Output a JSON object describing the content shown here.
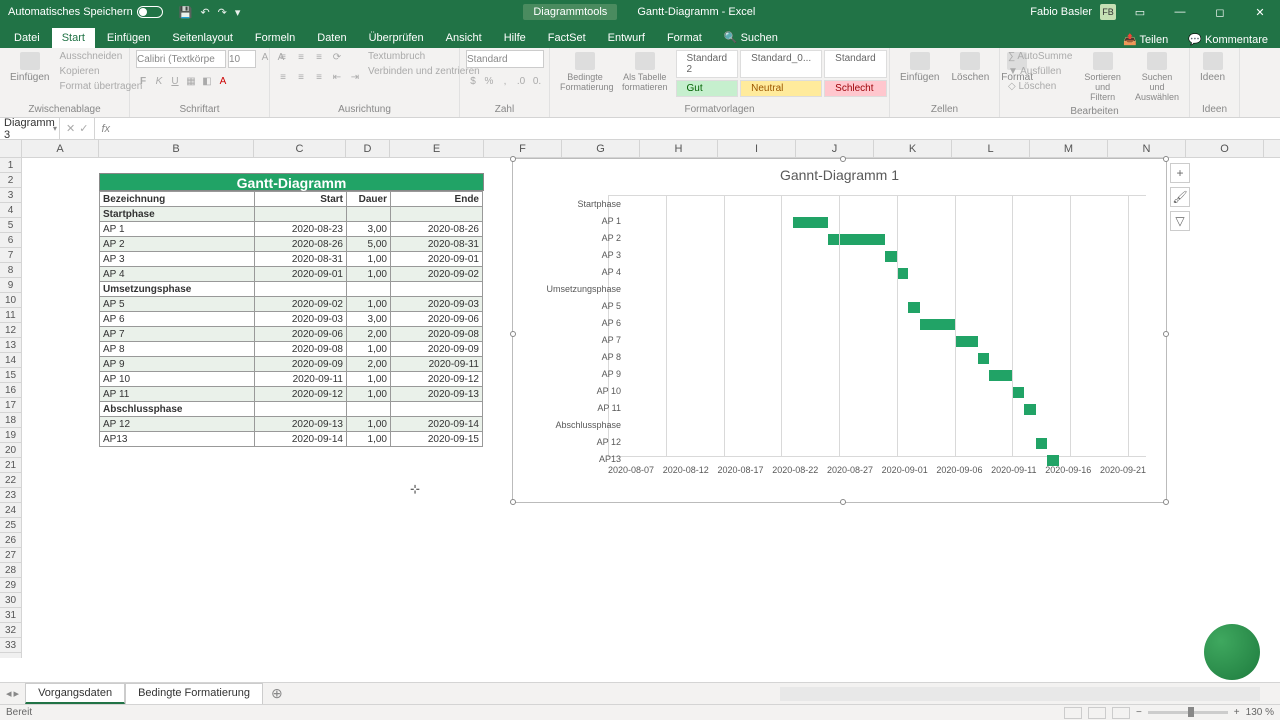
{
  "titlebar": {
    "autosave": "Automatisches Speichern",
    "tool_context": "Diagrammtools",
    "doc_title": "Gantt-Diagramm - Excel",
    "username": "Fabio Basler",
    "user_initials": "FB"
  },
  "ribbon_tabs": [
    "Datei",
    "Start",
    "Einfügen",
    "Seitenlayout",
    "Formeln",
    "Daten",
    "Überprüfen",
    "Ansicht",
    "Hilfe",
    "FactSet",
    "Entwurf",
    "Format"
  ],
  "ribbon_tabs_active": "Start",
  "ribbon_search": "Suchen",
  "ribbon_share": "Teilen",
  "ribbon_comments": "Kommentare",
  "ribbon": {
    "clipboard": {
      "label": "Zwischenablage",
      "paste": "Einfügen",
      "cut": "Ausschneiden",
      "copy": "Kopieren",
      "format_painter": "Format übertragen"
    },
    "font": {
      "label": "Schriftart",
      "name": "Calibri (Textkörpe",
      "size": "10"
    },
    "alignment": {
      "label": "Ausrichtung",
      "wrap": "Textumbruch",
      "merge": "Verbinden und zentrieren"
    },
    "number": {
      "label": "Zahl",
      "format": "Standard"
    },
    "styles": {
      "label": "Formatvorlagen",
      "cond": "Bedingte Formatierung",
      "as_table": "Als Tabelle formatieren",
      "boxes": [
        "Standard 2",
        "Standard_0...",
        "Standard",
        "Gut",
        "Neutral",
        "Schlecht"
      ]
    },
    "cells": {
      "label": "Zellen",
      "insert": "Einfügen",
      "delete": "Löschen",
      "format": "Format"
    },
    "editing": {
      "label": "Bearbeiten",
      "autosum": "AutoSumme",
      "fill": "Ausfüllen",
      "clear": "Löschen",
      "sort": "Sortieren und Filtern",
      "find": "Suchen und Auswählen"
    },
    "ideas": {
      "label": "Ideen",
      "btn": "Ideen"
    }
  },
  "name_box": "Diagramm 3",
  "columns": [
    "A",
    "B",
    "C",
    "D",
    "E",
    "F",
    "G",
    "H",
    "I",
    "J",
    "K",
    "L",
    "M",
    "N",
    "O"
  ],
  "table": {
    "title": "Gantt-Diagramm",
    "headers": [
      "Bezeichnung",
      "Start",
      "Dauer",
      "Ende"
    ],
    "rows": [
      {
        "b": "Startphase",
        "c": "",
        "d": "",
        "e": "",
        "phase": true
      },
      {
        "b": "AP 1",
        "c": "2020-08-23",
        "d": "3,00",
        "e": "2020-08-26"
      },
      {
        "b": "AP 2",
        "c": "2020-08-26",
        "d": "5,00",
        "e": "2020-08-31"
      },
      {
        "b": "AP 3",
        "c": "2020-08-31",
        "d": "1,00",
        "e": "2020-09-01"
      },
      {
        "b": "AP 4",
        "c": "2020-09-01",
        "d": "1,00",
        "e": "2020-09-02"
      },
      {
        "b": "Umsetzungsphase",
        "c": "",
        "d": "",
        "e": "",
        "phase": true
      },
      {
        "b": "AP 5",
        "c": "2020-09-02",
        "d": "1,00",
        "e": "2020-09-03"
      },
      {
        "b": "AP 6",
        "c": "2020-09-03",
        "d": "3,00",
        "e": "2020-09-06"
      },
      {
        "b": "AP 7",
        "c": "2020-09-06",
        "d": "2,00",
        "e": "2020-09-08"
      },
      {
        "b": "AP 8",
        "c": "2020-09-08",
        "d": "1,00",
        "e": "2020-09-09"
      },
      {
        "b": "AP 9",
        "c": "2020-09-09",
        "d": "2,00",
        "e": "2020-09-11"
      },
      {
        "b": "AP 10",
        "c": "2020-09-11",
        "d": "1,00",
        "e": "2020-09-12"
      },
      {
        "b": "AP 11",
        "c": "2020-09-12",
        "d": "1,00",
        "e": "2020-09-13"
      },
      {
        "b": "Abschlussphase",
        "c": "",
        "d": "",
        "e": "",
        "phase": true
      },
      {
        "b": "AP 12",
        "c": "2020-09-13",
        "d": "1,00",
        "e": "2020-09-14"
      },
      {
        "b": "AP13",
        "c": "2020-09-14",
        "d": "1,00",
        "e": "2020-09-15"
      }
    ]
  },
  "chart_data": {
    "type": "gantt-bar",
    "title": "Gannt-Diagramm 1",
    "x_ticks": [
      "2020-08-07",
      "2020-08-12",
      "2020-08-17",
      "2020-08-22",
      "2020-08-27",
      "2020-09-01",
      "2020-09-06",
      "2020-09-11",
      "2020-09-16",
      "2020-09-21"
    ],
    "x_range": [
      "2020-08-07",
      "2020-09-21"
    ],
    "categories": [
      "Startphase",
      "AP 1",
      "AP 2",
      "AP 3",
      "AP 4",
      "Umsetzungsphase",
      "AP 5",
      "AP 6",
      "AP 7",
      "AP 8",
      "AP 9",
      "AP 10",
      "AP 11",
      "Abschlussphase",
      "AP 12",
      "AP13"
    ],
    "bars": [
      {
        "name": "Startphase",
        "start": null,
        "duration": 0
      },
      {
        "name": "AP 1",
        "start": "2020-08-23",
        "duration": 3
      },
      {
        "name": "AP 2",
        "start": "2020-08-26",
        "duration": 5
      },
      {
        "name": "AP 3",
        "start": "2020-08-31",
        "duration": 1
      },
      {
        "name": "AP 4",
        "start": "2020-09-01",
        "duration": 1
      },
      {
        "name": "Umsetzungsphase",
        "start": null,
        "duration": 0
      },
      {
        "name": "AP 5",
        "start": "2020-09-02",
        "duration": 1
      },
      {
        "name": "AP 6",
        "start": "2020-09-03",
        "duration": 3
      },
      {
        "name": "AP 7",
        "start": "2020-09-06",
        "duration": 2
      },
      {
        "name": "AP 8",
        "start": "2020-09-08",
        "duration": 1
      },
      {
        "name": "AP 9",
        "start": "2020-09-09",
        "duration": 2
      },
      {
        "name": "AP 10",
        "start": "2020-09-11",
        "duration": 1
      },
      {
        "name": "AP 11",
        "start": "2020-09-12",
        "duration": 1
      },
      {
        "name": "Abschlussphase",
        "start": null,
        "duration": 0
      },
      {
        "name": "AP 12",
        "start": "2020-09-13",
        "duration": 1
      },
      {
        "name": "AP13",
        "start": "2020-09-14",
        "duration": 1
      }
    ]
  },
  "sheets": [
    "Vorgangsdaten",
    "Bedingte Formatierung"
  ],
  "sheet_active": "Vorgangsdaten",
  "status": {
    "ready": "Bereit",
    "zoom": "130 %"
  }
}
